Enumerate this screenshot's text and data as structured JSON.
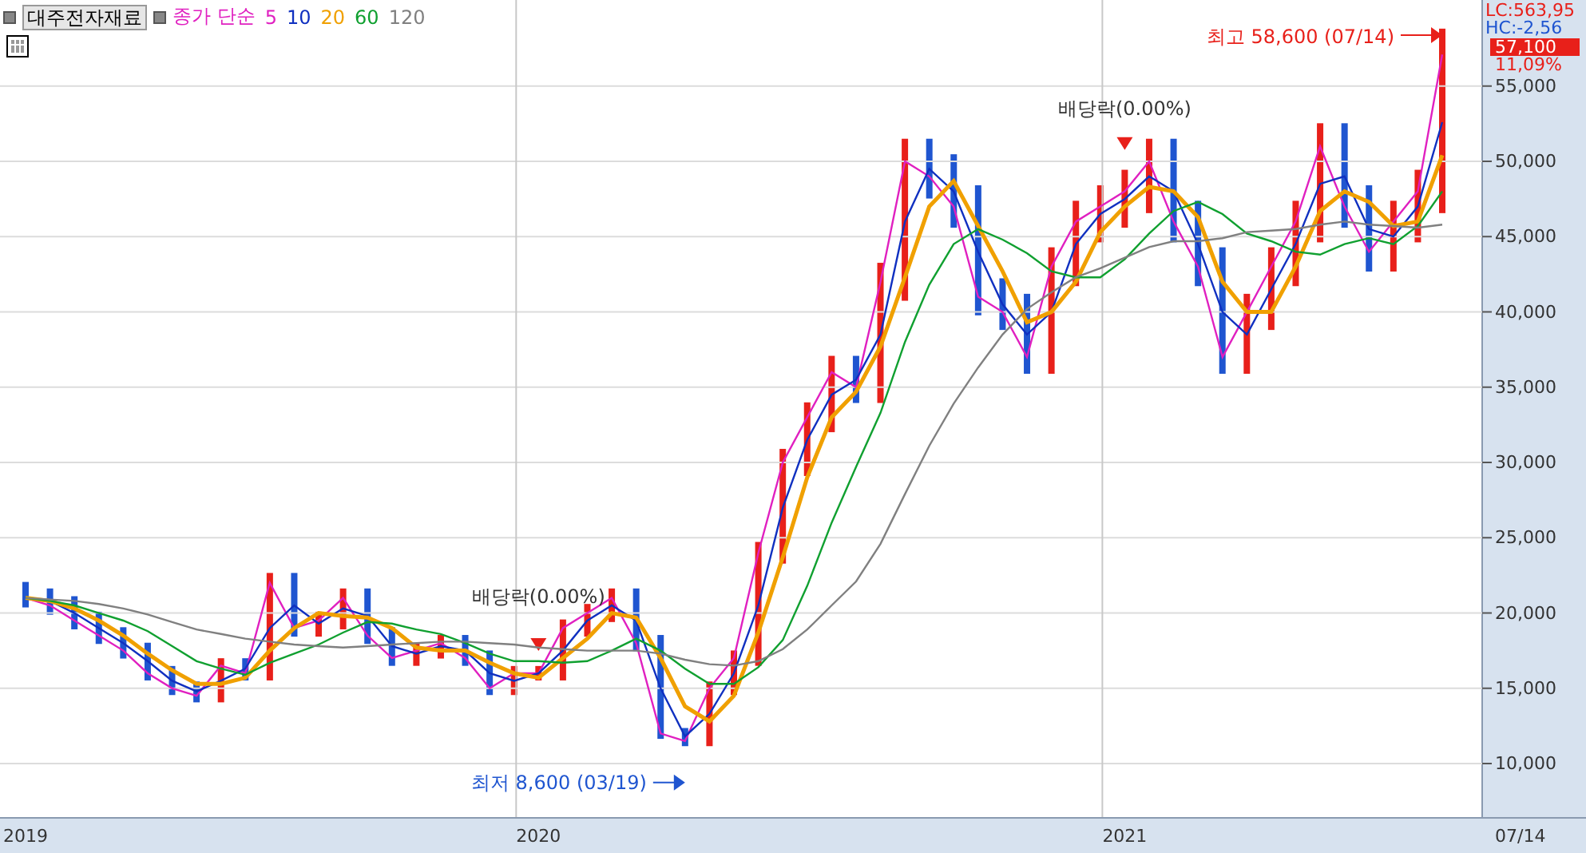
{
  "header": {
    "stock_button": "대주전자재료",
    "ma_type": "종가 단순"
  },
  "right_axis": {
    "lc": "LC:563,95",
    "hc": "HC:-2,56",
    "price": "57,100",
    "change": "11,09%",
    "last_date": "07/14"
  },
  "chart_data": {
    "type": "line",
    "categories": [
      "2019",
      null,
      null,
      null,
      null,
      null,
      null,
      null,
      null,
      null,
      null,
      null,
      null,
      null,
      null,
      null,
      null,
      null,
      null,
      null,
      null,
      "2020",
      null,
      null,
      null,
      null,
      null,
      null,
      null,
      null,
      null,
      null,
      null,
      null,
      null,
      null,
      null,
      null,
      null,
      null,
      null,
      null,
      null,
      null,
      null,
      "2021",
      null,
      null,
      null,
      null,
      null,
      null,
      null,
      null,
      null,
      null,
      null,
      null,
      null
    ],
    "series": [
      {
        "name": "5",
        "color": "#e020c0",
        "values": [
          21000,
          20500,
          19500,
          18500,
          17500,
          16000,
          15000,
          14500,
          16500,
          16000,
          22000,
          19000,
          19500,
          21000,
          18500,
          17000,
          17500,
          18000,
          17000,
          15000,
          16000,
          16000,
          19000,
          20000,
          21000,
          18000,
          12000,
          11500,
          15000,
          17000,
          24000,
          30000,
          33000,
          36000,
          35000,
          42000,
          50000,
          49000,
          47000,
          41000,
          40000,
          37000,
          43000,
          46000,
          47000,
          48000,
          50000,
          46000,
          43000,
          37000,
          40000,
          43000,
          46000,
          51000,
          47000,
          44000,
          46000,
          48000,
          57100
        ]
      },
      {
        "name": "10",
        "color": "#1030c0",
        "values": [
          21000,
          20800,
          20000,
          19000,
          18000,
          16800,
          15500,
          14800,
          15500,
          16300,
          19000,
          20500,
          19300,
          20300,
          19800,
          17800,
          17300,
          17800,
          17500,
          16000,
          15500,
          16000,
          17500,
          19500,
          20500,
          19500,
          15000,
          11800,
          13300,
          16000,
          20500,
          27000,
          31500,
          34500,
          35500,
          38500,
          46000,
          49500,
          48000,
          44000,
          40500,
          38500,
          40000,
          44500,
          46500,
          47500,
          49000,
          48000,
          44500,
          40000,
          38500,
          41500,
          44500,
          48500,
          49000,
          45500,
          45000,
          47000,
          52600
        ]
      },
      {
        "name": "20",
        "color": "#f0a000",
        "values": [
          21000,
          20800,
          20300,
          19500,
          18500,
          17300,
          16200,
          15300,
          15300,
          15700,
          17500,
          19000,
          20000,
          19800,
          19700,
          19000,
          17700,
          17500,
          17500,
          16700,
          16000,
          15700,
          17000,
          18300,
          20000,
          19700,
          17000,
          13800,
          12800,
          14500,
          18700,
          23700,
          29000,
          33000,
          34700,
          37700,
          42300,
          47000,
          48700,
          45700,
          42700,
          39300,
          40000,
          42000,
          45300,
          47000,
          48300,
          48000,
          46300,
          42000,
          40000,
          40000,
          43000,
          46700,
          48000,
          47300,
          45700,
          46000,
          50400
        ]
      },
      {
        "name": "60",
        "color": "#10a030",
        "values": [
          21000,
          20800,
          20500,
          20000,
          19500,
          18800,
          17800,
          16800,
          16300,
          15900,
          16700,
          17300,
          17900,
          18700,
          19400,
          19300,
          18900,
          18600,
          18000,
          17300,
          16800,
          16800,
          16700,
          16800,
          17500,
          18300,
          17500,
          16300,
          15300,
          15300,
          16400,
          18200,
          21800,
          26000,
          29700,
          33300,
          38000,
          41800,
          44500,
          45500,
          44800,
          43900,
          42700,
          42300,
          42300,
          43500,
          45200,
          46700,
          47300,
          46500,
          45200,
          44700,
          44000,
          43800,
          44500,
          44900,
          44500,
          45700,
          48000
        ]
      },
      {
        "name": "120",
        "color": "#808080",
        "values": [
          21000,
          20900,
          20800,
          20600,
          20300,
          19900,
          19400,
          18900,
          18600,
          18300,
          18100,
          17900,
          17800,
          17700,
          17800,
          17900,
          18000,
          18100,
          18100,
          18000,
          17900,
          17700,
          17600,
          17500,
          17500,
          17500,
          17300,
          16900,
          16600,
          16500,
          16800,
          17600,
          18900,
          20500,
          22100,
          24600,
          27900,
          31100,
          33900,
          36300,
          38500,
          40200,
          41300,
          42300,
          42900,
          43600,
          44300,
          44700,
          44700,
          44900,
          45300,
          45400,
          45500,
          45800,
          46000,
          45800,
          45700,
          45600,
          45800
        ]
      }
    ],
    "ylim": [
      6393,
      60716
    ],
    "grid": true,
    "yticks": [
      {
        "value": 10000,
        "label": "10,000"
      },
      {
        "value": 15000,
        "label": "15,000"
      },
      {
        "value": 20000,
        "label": "20,000"
      },
      {
        "value": 25000,
        "label": "25,000"
      },
      {
        "value": 30000,
        "label": "30,000"
      },
      {
        "value": 35000,
        "label": "35,000"
      },
      {
        "value": 40000,
        "label": "40,000"
      },
      {
        "value": 45000,
        "label": "45,000"
      },
      {
        "value": 50000,
        "label": "50,000"
      },
      {
        "value": 55000,
        "label": "55,000"
      }
    ],
    "annotations": [
      "최고 58,600 (07/14)",
      "최저 8,600 (03/19)",
      "배당락(0.00%)",
      "배당락(0.00%)"
    ]
  }
}
